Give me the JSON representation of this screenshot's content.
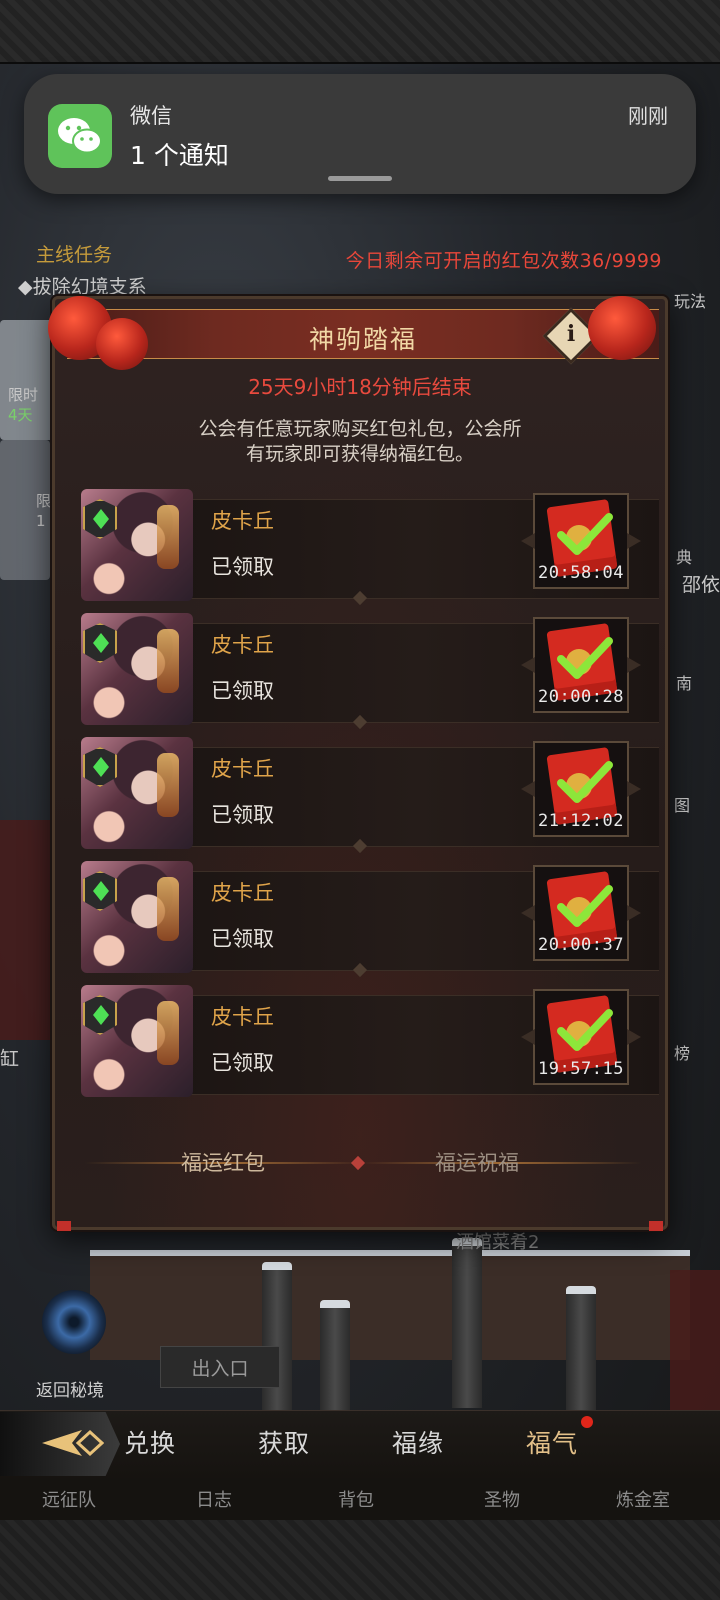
{
  "notification": {
    "app_name": "微信",
    "message": "1 个通知",
    "time": "刚刚",
    "icon": "wechat-icon"
  },
  "background": {
    "quest_title": "主线任务",
    "quest_sub": "◆拔除幻境支系",
    "remaining_text": "今日剩余可开启的红包次数36/9999",
    "left_labels": [
      "限时",
      "4天",
      "限",
      "1"
    ],
    "right_labels": [
      "玩法",
      "典",
      "邵依",
      "南",
      "图",
      "榜"
    ],
    "edge_left_label": "缸",
    "portal_label": "返回秘境",
    "exit_label": "出入口",
    "tavern_label": "酒馆菜肴2"
  },
  "dialog": {
    "title": "神驹踏福",
    "countdown": "25天9小时18分钟后结束",
    "desc_line1": "公会有任意玩家购买红包礼包，公会所",
    "desc_line2": "有玩家即可获得纳福红包。",
    "info_icon": "info-icon",
    "rows": [
      {
        "name": "皮卡丘",
        "status": "已领取",
        "time": "20:58:04"
      },
      {
        "name": "皮卡丘",
        "status": "已领取",
        "time": "20:00:28"
      },
      {
        "name": "皮卡丘",
        "status": "已领取",
        "time": "21:12:02"
      },
      {
        "name": "皮卡丘",
        "status": "已领取",
        "time": "20:00:37"
      },
      {
        "name": "皮卡丘",
        "status": "已领取",
        "time": "19:57:15"
      }
    ],
    "tabs": [
      "福运红包",
      "福运祝福"
    ]
  },
  "bottom_nav": {
    "tabs": [
      "兑换",
      "获取",
      "福缘",
      "福气"
    ],
    "active_tab": "福气",
    "lower_items": [
      "远征队",
      "日志",
      "背包",
      "圣物",
      "炼金室"
    ]
  },
  "colors": {
    "accent_gold": "#e0a44a",
    "countdown_red": "#e84a3e",
    "wechat_green": "#5fc35a"
  }
}
